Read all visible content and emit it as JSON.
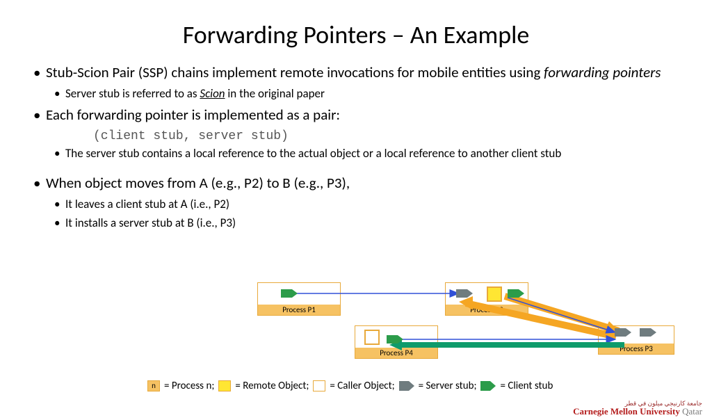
{
  "title": "Forwarding Pointers – An Example",
  "bullets": {
    "l1a_pre": "Stub-Scion Pair (SSP) chains implement remote invocations for mobile entities using ",
    "l1a_em": "forwarding pointers",
    "l2a_pre": "Server stub is referred to as ",
    "l2a_em": "Scion",
    "l2a_post": " in the original paper",
    "l1b": "Each forwarding pointer is implemented as a pair:",
    "mono": "(client stub, server stub)",
    "l2b": "The server stub contains a local reference to the actual object or a local reference to another client stub",
    "l1c": "When object moves from A (e.g., P2) to B (e.g., P3),",
    "l2c1": "It leaves a client stub at A (i.e., P2)",
    "l2c2": "It installs a server stub at B (i.e., P3)"
  },
  "processes": {
    "p1": "Process P1",
    "p2": "Process P2",
    "p3": "Process P3",
    "p4": "Process P4"
  },
  "legend": {
    "n": "n",
    "process_n": " = Process n; ",
    "remote": " = Remote Object; ",
    "caller": " = Caller Object; ",
    "server": " = Server stub; ",
    "client": " = Client stub"
  },
  "footer": {
    "arabic": "جامعة كارنيجي ميلون في قطر",
    "cmu": "Carnegie Mellon University",
    "qatar": " Qatar"
  }
}
